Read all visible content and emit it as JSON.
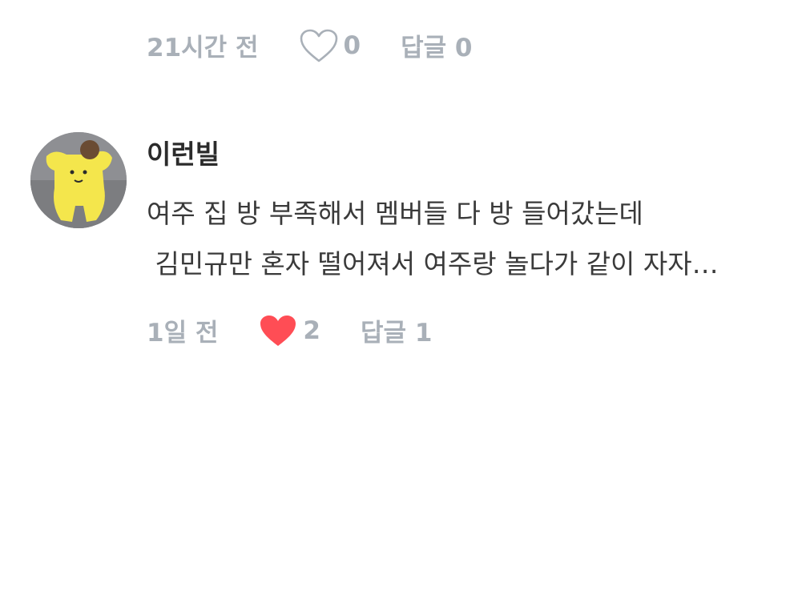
{
  "prev_comment": {
    "time": "21시간 전",
    "like_icon": "heart-outline-icon",
    "like_count": "0",
    "reply_label": "답글 0"
  },
  "comment": {
    "username": "이런빌",
    "text_line1": "여주 집 방 부족해서 멤버들 다 방 들어갔는데",
    "text_line2": " 김민규만 혼자 떨어져서 여주랑 놀다가 같이 자자…",
    "time": "1일 전",
    "like_icon": "heart-filled-icon",
    "like_count": "2",
    "reply_label": "답글 1"
  },
  "colors": {
    "meta_gray": "#a9b0b8",
    "heart_red": "#ff4d55",
    "text_dark": "#2b2b2b"
  }
}
